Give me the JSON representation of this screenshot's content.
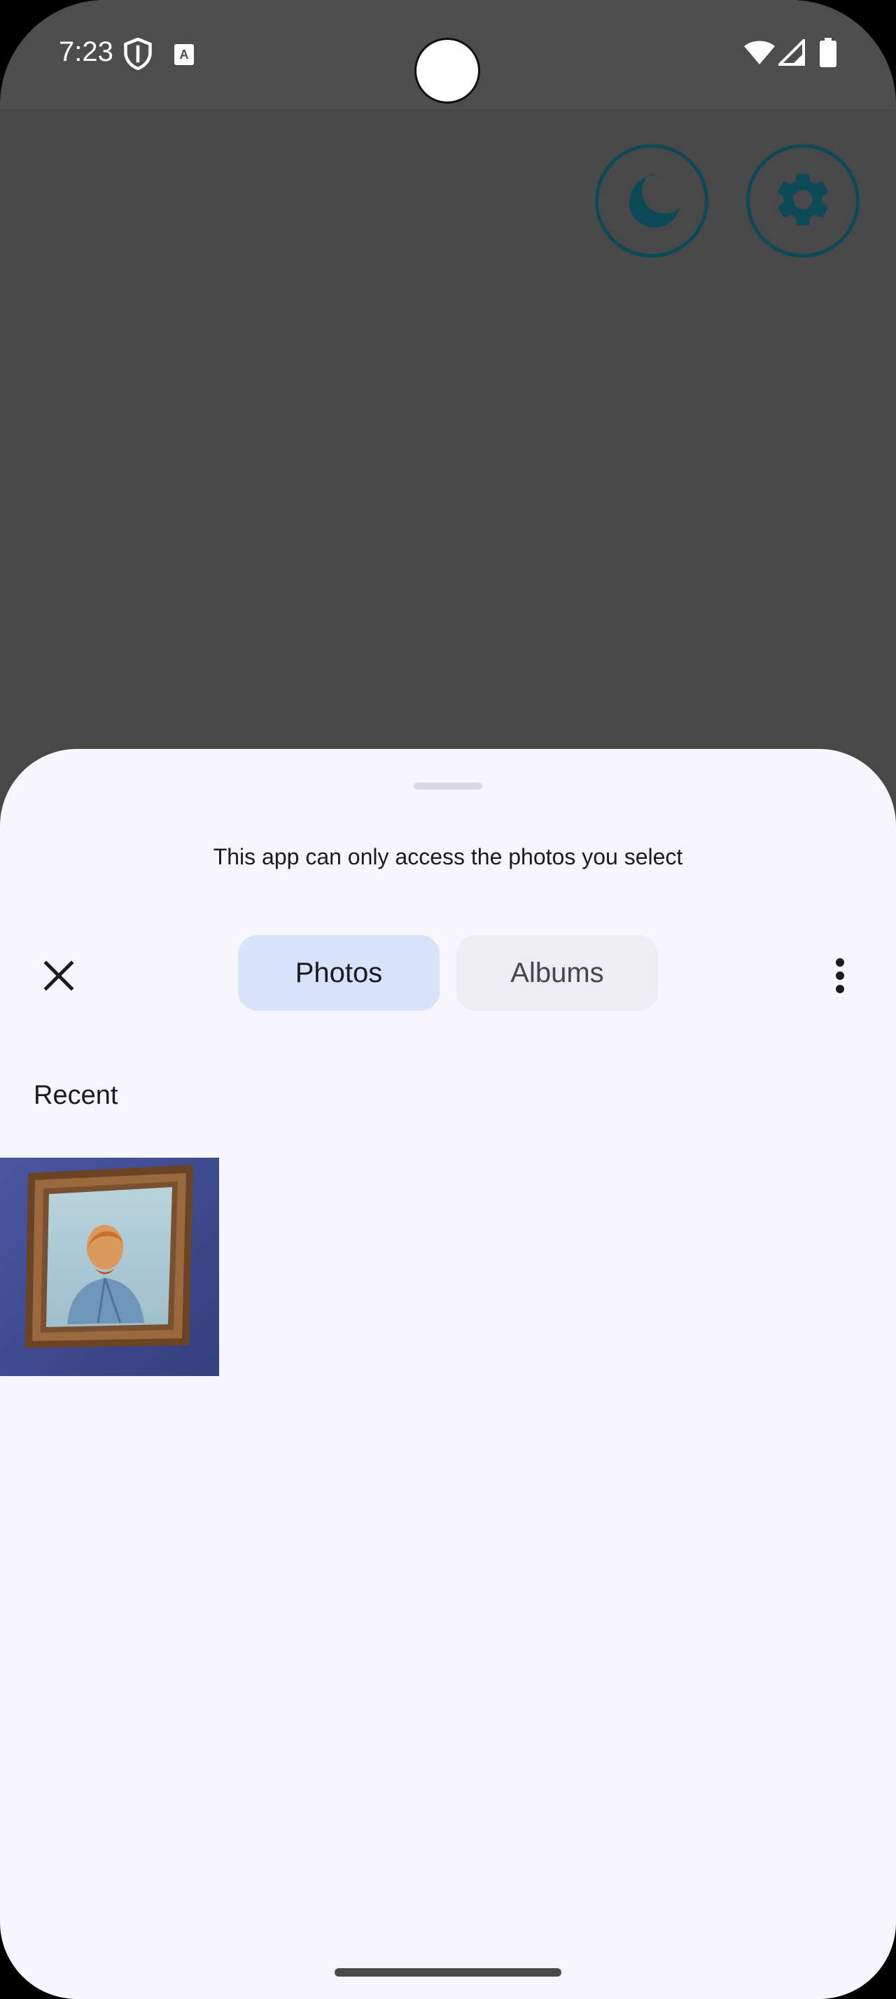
{
  "status_bar": {
    "time": "7:23",
    "left_icons": [
      "shield-icon",
      "text-a-icon"
    ],
    "right_icons": [
      "wifi-icon",
      "signal-icon",
      "battery-icon"
    ]
  },
  "app": {
    "buttons": [
      {
        "name": "dark-mode-button",
        "icon": "moon-icon"
      },
      {
        "name": "settings-button",
        "icon": "gear-icon"
      }
    ],
    "accent_color": "#0b4a56"
  },
  "picker": {
    "message": "This app can only access the photos you select",
    "close_icon": "close-icon",
    "tabs": [
      {
        "label": "Photos",
        "selected": true
      },
      {
        "label": "Albums",
        "selected": false
      }
    ],
    "more_icon": "more-vert-icon",
    "section_title": "Recent",
    "photos": [
      {
        "description_icon": "portrait-painting-thumbnail"
      }
    ],
    "colors": {
      "sheet_bg": "#f7f6fc",
      "selected_tab": "#d8e2fb",
      "unselected_tab": "#ededf2"
    }
  }
}
